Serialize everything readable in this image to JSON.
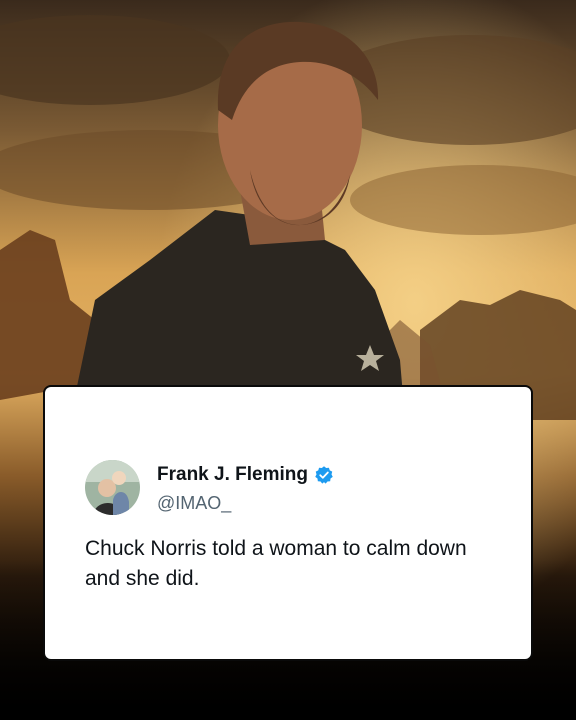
{
  "tweet": {
    "author_name": "Frank J. Fleming",
    "handle": "@IMAO_",
    "text": "Chuck Norris told a woman to calm down and she did.",
    "verified": true,
    "verified_color": "#1d9bf0"
  },
  "background": {
    "sky_color": "#c98f3c",
    "shadow_color": "#000000"
  }
}
